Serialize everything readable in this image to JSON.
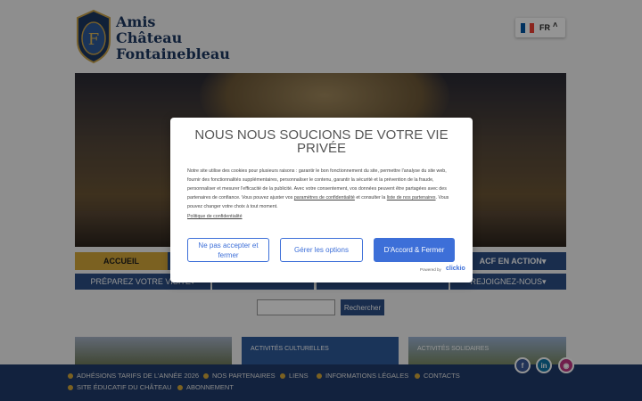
{
  "brand": {
    "line1": "Amis",
    "line2": "Château",
    "line3": "Fontainebleau",
    "monogram": "F"
  },
  "language": {
    "code": "FR"
  },
  "nav_primary": [
    {
      "label": "ACCUEIL"
    },
    {
      "label": "ACF EN ACTION"
    }
  ],
  "nav_secondary": [
    {
      "label": "PRÉPAREZ VOTRE VISITE"
    },
    {
      "label": "REJOIGNEZ-NOUS"
    }
  ],
  "search": {
    "placeholder": "",
    "button_label": "Rechercher"
  },
  "cards": [
    {
      "label": ""
    },
    {
      "label": "ACTIVITÉS CULTURELLES"
    },
    {
      "label": "ACTIVITÉS SOLIDAIRES"
    }
  ],
  "footer": {
    "links": [
      "ADHÉSIONS TARIFS DE L'ANNÉE 2026",
      "NOS PARTENAIRES",
      "LIENS",
      "INFORMATIONS LÉGALES",
      "CONTACTS",
      "SITE ÉDUCATIF DU CHÂTEAU",
      "ABONNEMENT"
    ],
    "social": [
      "facebook-icon",
      "linkedin-icon",
      "instagram-icon"
    ]
  },
  "consent": {
    "title": "NOUS NOUS SOUCIONS DE VOTRE VIE PRIVÉE",
    "body_1": "Notre site utilise des cookies pour plusieurs raisons : garantir le bon fonctionnement du site, permettre l'analyse du site web, fournir des fonctionnalités supplémentaires, personnaliser le contenu, garantir la sécurité et la prévention de la fraude, personnaliser et mesurer l'efficacité de la publicité. Avec votre consentement, vos données peuvent être partagées avec des partenaires de confiance. Vous pouvez ajuster vos ",
    "link_settings": "paramètres de confidentialité",
    "body_2": " et consulter la ",
    "link_partners": "liste de nos partenaires",
    "body_3": ". Vous pouvez changer votre choix à tout moment.",
    "policy_link": "Politique de confidentialité",
    "btn_reject": "Ne pas accepter et fermer",
    "btn_options": "Gérer les options",
    "btn_accept": "D'Accord & Fermer",
    "powered_by": "Powered by",
    "powered_brand": "clickio"
  },
  "colors": {
    "navy": "#1f3b6b",
    "gold": "#d4a83a",
    "accent_blue": "#3d6fd8",
    "nav_blue": "#2b4f86"
  }
}
